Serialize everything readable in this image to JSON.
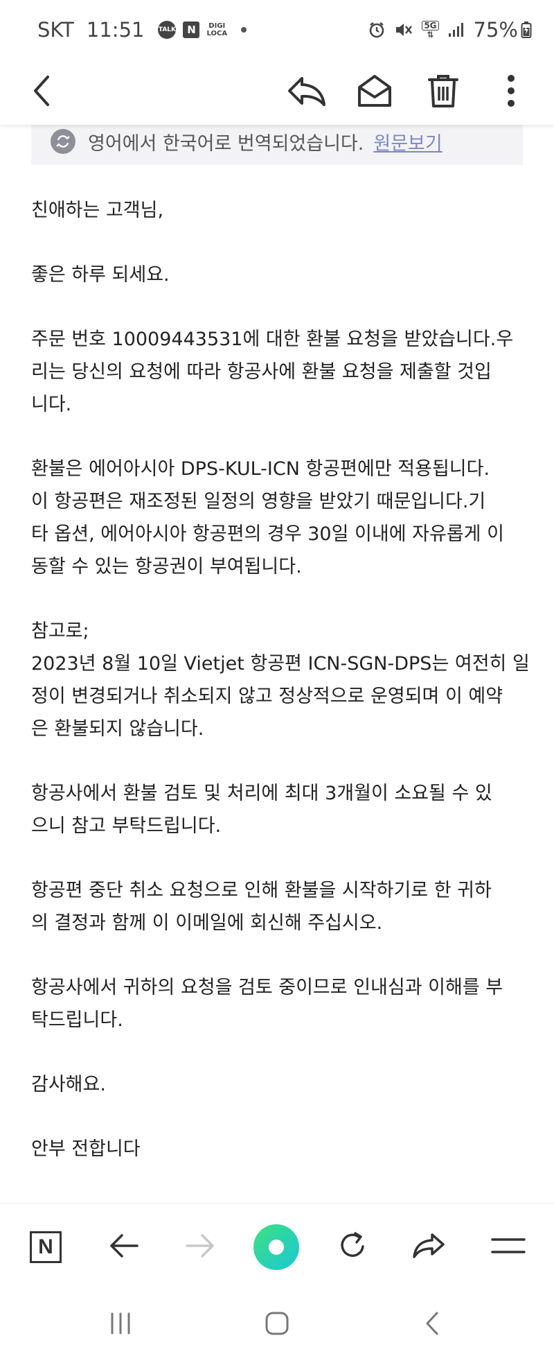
{
  "status_bar": {
    "carrier": "SKT",
    "time": "11:51",
    "talk_badge": "TALK",
    "n_badge": "N",
    "digi_badge_line1": "DIGI",
    "digi_badge_line2": "LOCA",
    "network": "5G",
    "battery": "75%"
  },
  "toolbar": {
    "icons": [
      "back-icon",
      "reply-icon",
      "mark-unread-icon",
      "delete-icon",
      "more-icon"
    ]
  },
  "translation_banner": {
    "text": "영어에서 한국어로 번역되었습니다.",
    "link_label": "원문보기"
  },
  "email": {
    "paragraphs": [
      "친애하는 고객님,",
      "좋은 하루 되세요.",
      "주문 번호 10009443531에 대한 환불 요청을 받았습니다.우\n리는 당신의 요청에 따라 항공사에 환불 요청을 제출할 것입\n니다.",
      "환불은 에어아시아 DPS-KUL-ICN 항공편에만 적용됩니다.\n이 항공편은 재조정된 일정의 영향을 받았기 때문입니다.기\n타 옵션, 에어아시아 항공편의 경우 30일 이내에 자유롭게 이\n동할 수 있는 항공권이 부여됩니다.",
      "참고로;\n2023년 8월 10일 Vietjet 항공편 ICN-SGN-DPS는 여전히 일\n정이 변경되거나 취소되지 않고 정상적으로 운영되며 이 예약\n은 환불되지 않습니다.",
      "항공사에서 환불 검토 및 처리에 최대 3개월이 소요될 수 있\n으니 참고 부탁드립니다.",
      "항공편 중단 취소 요청으로 인해 환불을 시작하기로 한 귀하\n의 결정과 함께 이 이메일에 회신해 주십시오.",
      "항공사에서 귀하의 요청을 검토 중이므로 인내심과 이해를 부\n탁드립니다.",
      "감사해요.",
      "안부 전합니다"
    ]
  },
  "browser_bar": {
    "n_logo": "N",
    "icons": [
      "naver-logo-icon",
      "back-arrow-icon",
      "forward-arrow-icon",
      "green-dot-icon",
      "refresh-icon",
      "share-icon",
      "menu-icon"
    ],
    "colors": {
      "green_start": "#3fe07e",
      "green_end": "#19c8d8",
      "disabled": "#c8c8c8"
    }
  },
  "nav_bar": {
    "icons": [
      "recent-apps-icon",
      "home-icon",
      "system-back-icon"
    ]
  }
}
